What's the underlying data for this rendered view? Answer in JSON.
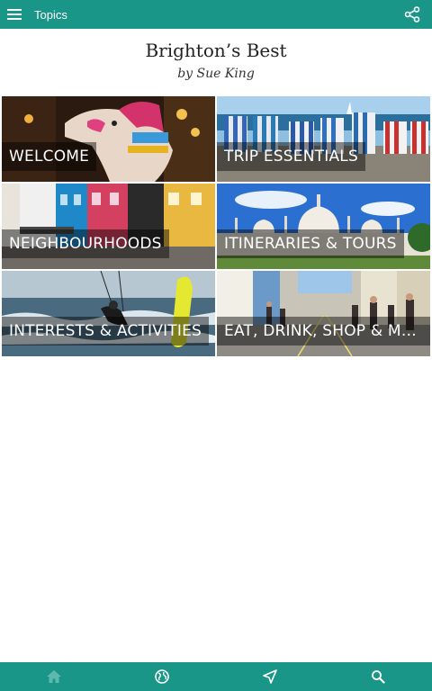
{
  "appbar": {
    "title": "Topics",
    "menu_icon": "hamburger-menu-icon",
    "share_icon": "share-icon",
    "color": "#1a9688"
  },
  "book": {
    "title": "Brighton’s Best",
    "author": "by Sue King"
  },
  "topics": [
    {
      "label": "WELCOME",
      "image": "carousel-horse"
    },
    {
      "label": "TRIP ESSENTIALS",
      "image": "deckchairs-beach"
    },
    {
      "label": "NEIGHBOURHOODS",
      "image": "colourful-street"
    },
    {
      "label": "ITINERARIES & TOURS",
      "image": "royal-pavilion"
    },
    {
      "label": "INTERESTS & ACTIVITIES",
      "image": "kitesurfer"
    },
    {
      "label": "EAT, DRINK, SHOP & MO...",
      "image": "shopping-street"
    }
  ],
  "bottom_nav": [
    {
      "name": "home-icon",
      "active": false
    },
    {
      "name": "globe-icon",
      "active": true
    },
    {
      "name": "navigate-icon",
      "active": true
    },
    {
      "name": "search-icon",
      "active": true
    }
  ]
}
